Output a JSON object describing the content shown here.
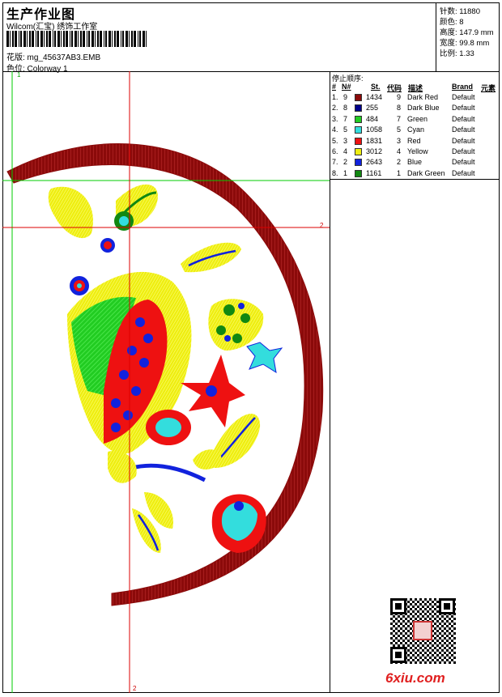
{
  "header": {
    "title": "生产作业图",
    "software": "Wilcom(汇宝) 绣饰工作室",
    "file_label": "花版: mg_45637AB3.EMB",
    "colorway_label": "色位:  Colorway 1"
  },
  "stats": [
    {
      "label": "针数:",
      "value": "11880"
    },
    {
      "label": "颜色:",
      "value": "8"
    },
    {
      "label": "高度:",
      "value": "147.9 mm"
    },
    {
      "label": "宽度:",
      "value": "99.8 mm"
    },
    {
      "label": "比例:",
      "value": "1.33"
    }
  ],
  "stop_sequence": {
    "title": "停止顺序:",
    "headers": [
      "#",
      "N#",
      "St.",
      "代码",
      "描述",
      "Brand",
      "元素"
    ],
    "rows": [
      {
        "idx": "1.",
        "n": "9",
        "color": "#8b0a0a",
        "stitches": "1434",
        "code": "9",
        "desc": "Dark Red",
        "brand": "Default"
      },
      {
        "idx": "2.",
        "n": "8",
        "color": "#00008b",
        "stitches": "255",
        "code": "8",
        "desc": "Dark Blue",
        "brand": "Default"
      },
      {
        "idx": "3.",
        "n": "7",
        "color": "#22cc22",
        "stitches": "484",
        "code": "7",
        "desc": "Green",
        "brand": "Default"
      },
      {
        "idx": "4.",
        "n": "5",
        "color": "#33dddd",
        "stitches": "1058",
        "code": "5",
        "desc": "Cyan",
        "brand": "Default"
      },
      {
        "idx": "5.",
        "n": "3",
        "color": "#ee1111",
        "stitches": "1831",
        "code": "3",
        "desc": "Red",
        "brand": "Default"
      },
      {
        "idx": "6.",
        "n": "4",
        "color": "#eeee11",
        "stitches": "3012",
        "code": "4",
        "desc": "Yellow",
        "brand": "Default"
      },
      {
        "idx": "7.",
        "n": "2",
        "color": "#1122dd",
        "stitches": "2643",
        "code": "2",
        "desc": "Blue",
        "brand": "Default"
      },
      {
        "idx": "8.",
        "n": "1",
        "color": "#118811",
        "stitches": "1161",
        "code": "1",
        "desc": "Dark Green",
        "brand": "Default"
      }
    ]
  },
  "guides": {
    "marker_1": "1",
    "marker_2": "2"
  },
  "watermark": "6xiu.com",
  "colors": {
    "dark_red": "#8b0a0a",
    "guide_red": "#dd0000",
    "guide_green": "#00cc00"
  }
}
